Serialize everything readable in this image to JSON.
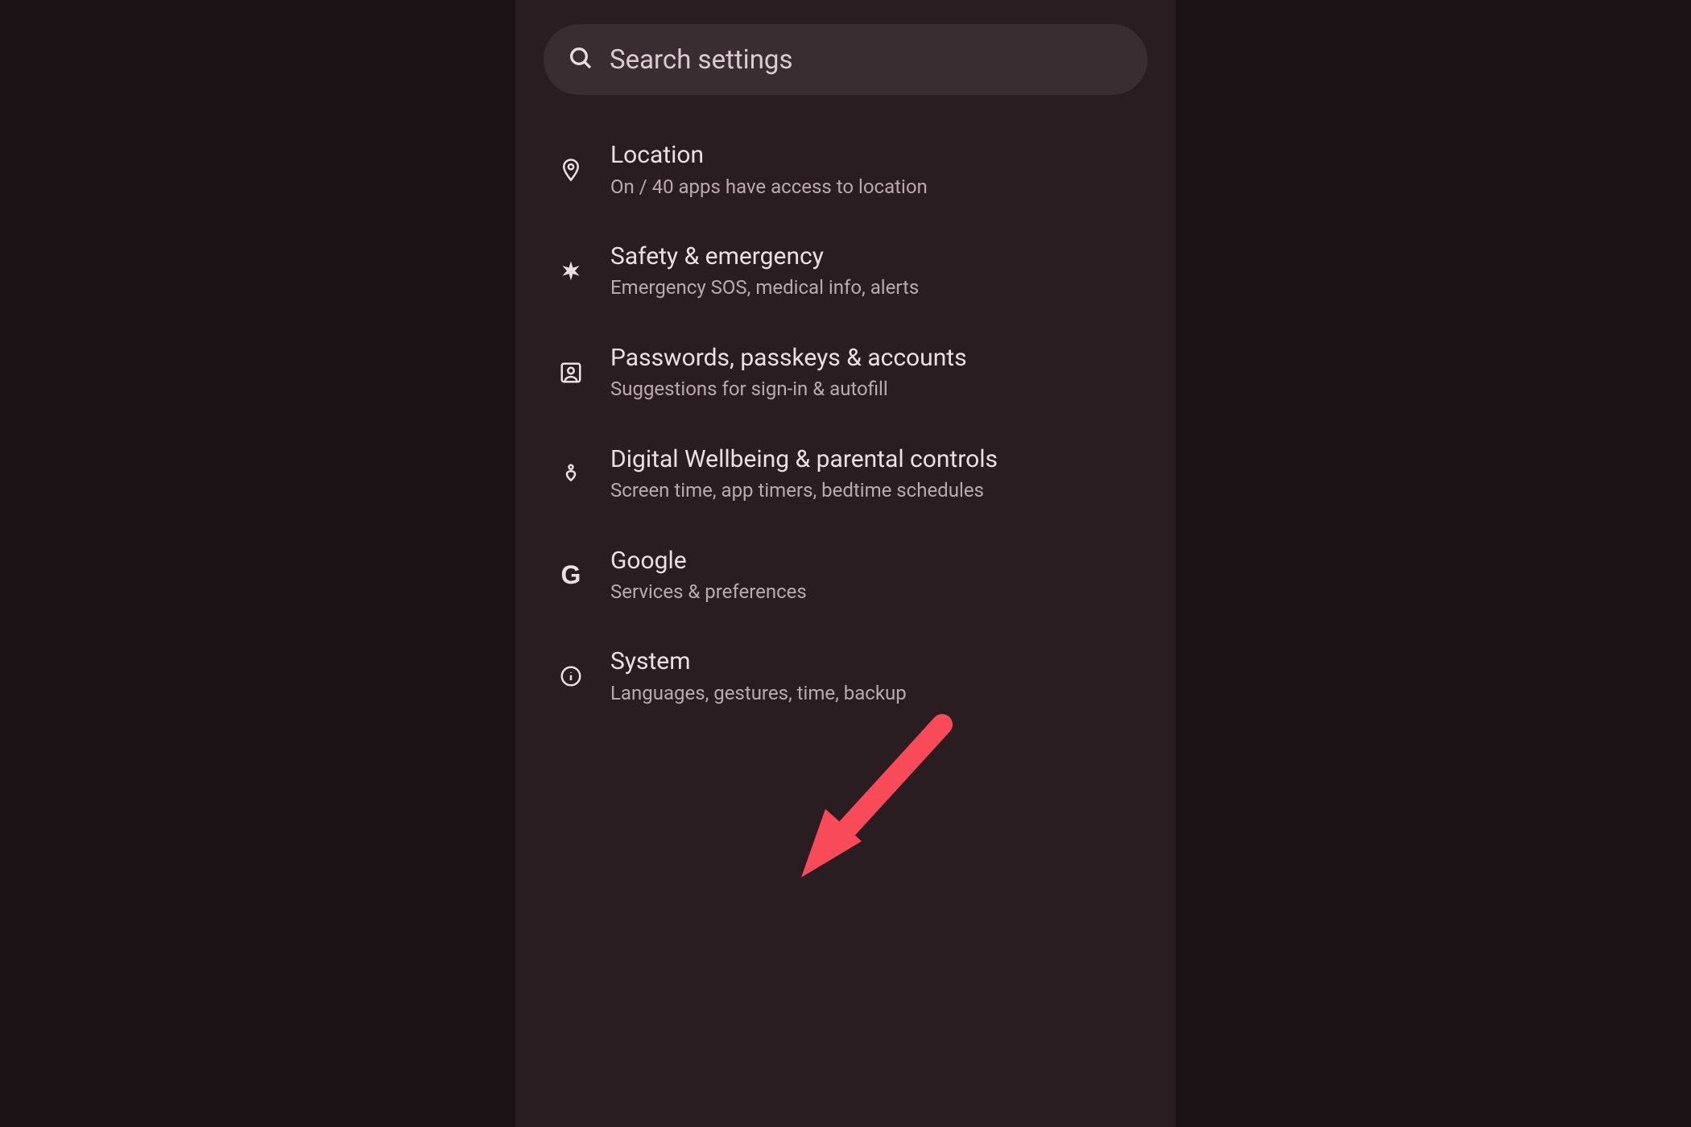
{
  "search": {
    "placeholder": "Search settings"
  },
  "settings": {
    "items": [
      {
        "icon": "location-icon",
        "title": "Location",
        "subtitle": "On / 40 apps have access to location"
      },
      {
        "icon": "asterisk-icon",
        "title": "Safety & emergency",
        "subtitle": "Emergency SOS, medical info, alerts"
      },
      {
        "icon": "account-icon",
        "title": "Passwords, passkeys & accounts",
        "subtitle": "Suggestions for sign-in & autofill"
      },
      {
        "icon": "wellbeing-icon",
        "title": "Digital Wellbeing & parental controls",
        "subtitle": "Screen time, app timers, bedtime schedules"
      },
      {
        "icon": "google-icon",
        "title": "Google",
        "subtitle": "Services & preferences"
      },
      {
        "icon": "info-icon",
        "title": "System",
        "subtitle": "Languages, gestures, time, backup"
      }
    ]
  },
  "annotation": {
    "arrow_color": "#f94a5a",
    "target": "google"
  }
}
